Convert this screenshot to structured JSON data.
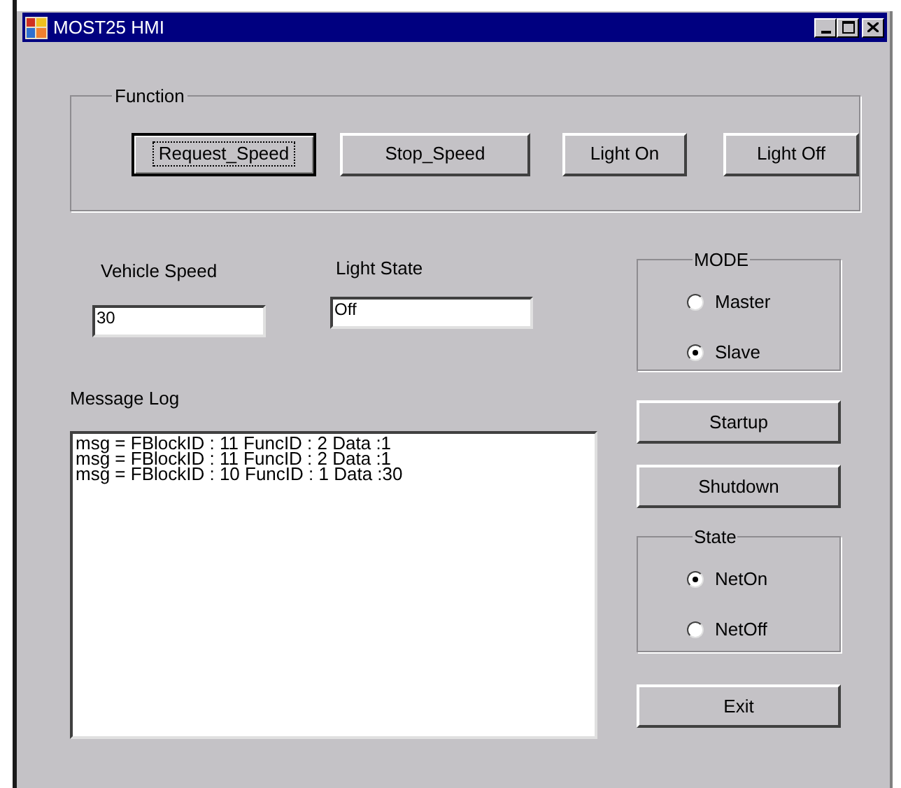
{
  "window": {
    "title": "MOST25 HMI"
  },
  "function_group": {
    "label": "Function",
    "buttons": [
      {
        "label": "Request_Speed",
        "focused": true
      },
      {
        "label": "Stop_Speed",
        "focused": false
      },
      {
        "label": "Light On",
        "focused": false
      },
      {
        "label": "Light Off",
        "focused": false
      }
    ]
  },
  "fields": [
    {
      "label": "Vehicle Speed",
      "value": "30"
    },
    {
      "label": "Light State",
      "value": "Off"
    }
  ],
  "message_log": {
    "label": "Message Log",
    "lines": [
      "msg = FBlockID : 11 FuncID : 2 Data :1",
      "msg = FBlockID : 11 FuncID : 2 Data :1",
      "msg = FBlockID : 10 FuncID : 1 Data :30"
    ]
  },
  "mode_group": {
    "label": "MODE",
    "options": [
      {
        "label": "Master",
        "selected": false
      },
      {
        "label": "Slave",
        "selected": true
      }
    ]
  },
  "startup_button": "Startup",
  "shutdown_button": "Shutdown",
  "state_group": {
    "label": "State",
    "options": [
      {
        "label": "NetOn",
        "selected": true
      },
      {
        "label": "NetOff",
        "selected": false
      }
    ]
  },
  "exit_button": "Exit"
}
